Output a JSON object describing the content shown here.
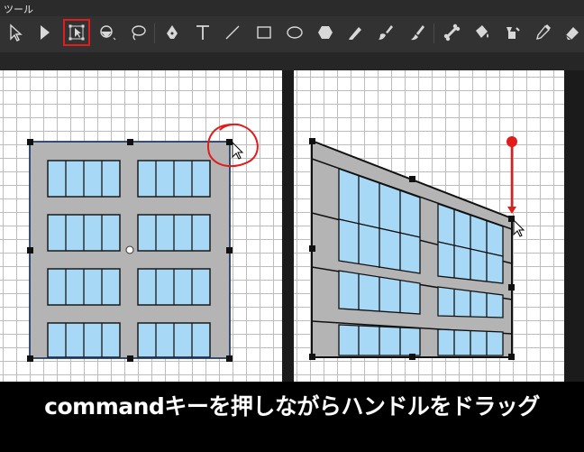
{
  "panel": {
    "title": "ツール"
  },
  "toolbar": {
    "tools": [
      {
        "icon": "selection-tool-icon"
      },
      {
        "icon": "direct-selection-tool-icon"
      },
      {
        "icon": "free-transform-tool-icon",
        "selected": true
      },
      {
        "icon": "shape-builder-tool-icon"
      },
      {
        "icon": "lasso-tool-icon"
      },
      {
        "icon": "pen-tool-icon"
      },
      {
        "icon": "type-tool-icon",
        "glyph": "T"
      },
      {
        "icon": "line-tool-icon"
      },
      {
        "icon": "rectangle-tool-icon"
      },
      {
        "icon": "ellipse-tool-icon"
      },
      {
        "icon": "polygon-tool-icon"
      },
      {
        "icon": "pencil-tool-icon"
      },
      {
        "icon": "blob-brush-tool-icon"
      },
      {
        "icon": "paintbrush-tool-icon"
      },
      {
        "icon": "bone-tool-icon"
      },
      {
        "icon": "paint-bucket-tool-icon"
      },
      {
        "icon": "ink-bottle-tool-icon"
      },
      {
        "icon": "eyedropper-tool-icon"
      },
      {
        "icon": "eraser-tool-icon"
      }
    ],
    "selected_outline_color": "#e21b1b"
  },
  "caption": {
    "text": "commandキーを押しながらハンドルをドラッグ"
  },
  "colors": {
    "wall": "#b4b4b4",
    "window": "#a7d9f7",
    "annotation": "#e21b1b",
    "bounding_box": "#1f3a6e"
  }
}
